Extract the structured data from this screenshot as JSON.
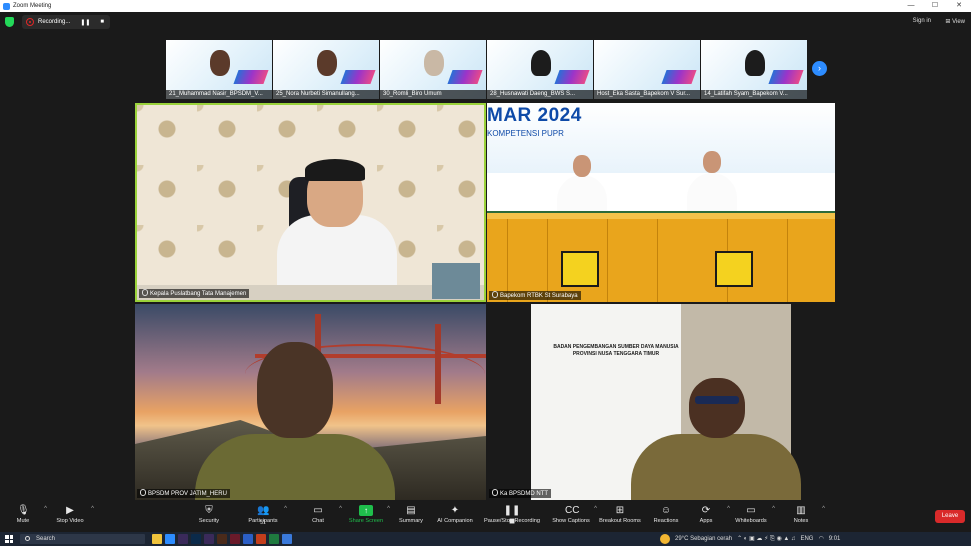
{
  "window": {
    "title": "Zoom Meeting"
  },
  "topbar": {
    "recording_label": "Recording...",
    "pause_icon": "pause-icon",
    "stop_icon": "stop-icon",
    "sign_in": "Sign in",
    "view": "View"
  },
  "thumbnails": [
    {
      "label": "21_Muhammad Nasir_BPSDM_V..."
    },
    {
      "label": "25_Nora Nurbeti Simanullang..."
    },
    {
      "label": "30_Romli_Biro Umum"
    },
    {
      "label": "28_Husnawati Daeng_BWS S..."
    },
    {
      "label": "Host_Eka Sasta_Bapekom V Sur..."
    },
    {
      "label": "14_Latifah Syam_Bapekom V..."
    }
  ],
  "tiles": {
    "t1": {
      "name": "Kepala Puslatbang Tata Manajemen"
    },
    "t2": {
      "name": "Bapekom RTBK St Surabaya",
      "slide_title": "MAR 2024",
      "slide_subtitle": "KOMPETENSI PUPR"
    },
    "t3": {
      "name": "BPSDM PROV JATIM_HERU"
    },
    "t4": {
      "name": "Ka BPSDMD NTT",
      "banner": "BADAN PENGEMBANGAN SUMBER DAYA MANUSIA PROVINSI NUSA TENGGARA TIMUR"
    }
  },
  "toolbar": {
    "mute": "Mute",
    "stop_video": "Stop Video",
    "security": "Security",
    "participants": "Participants",
    "participants_count": "51",
    "chat": "Chat",
    "share_screen": "Share Screen",
    "summary": "Summary",
    "ai_companion": "AI Companion",
    "pause_recording": "Pause/Stop Recording",
    "captions": "Show Captions",
    "breakout": "Breakout Rooms",
    "reactions": "Reactions",
    "apps": "Apps",
    "whiteboards": "Whiteboards",
    "notes": "Notes",
    "leave": "Leave"
  },
  "taskbar": {
    "search_placeholder": "Search",
    "weather": "29°C  Sebagian cerah",
    "lang": "ENG",
    "time": "9:01"
  },
  "colors": {
    "accent": "#2d8cff",
    "share_green": "#1fbf4c",
    "leave_red": "#d92a2a",
    "active_speaker": "#9ad23a"
  }
}
